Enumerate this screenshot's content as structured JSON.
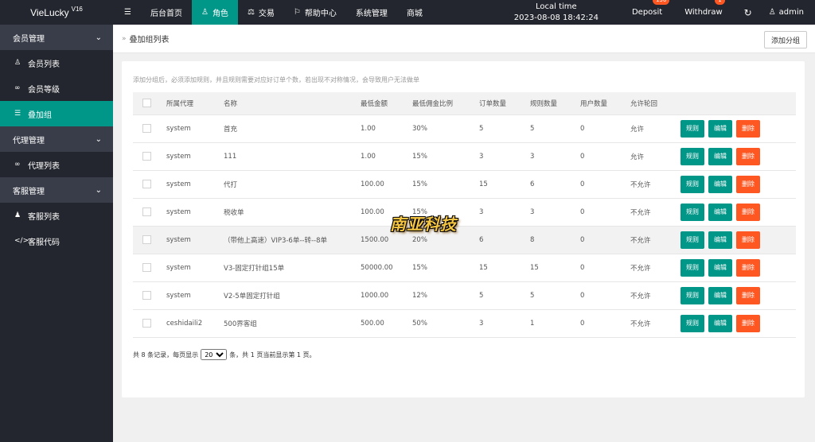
{
  "app": {
    "title": "VieLucky",
    "version": "V16"
  },
  "topnav": {
    "menu_icon": "menu-icon",
    "items": [
      {
        "label": "后台首页",
        "icon": ""
      },
      {
        "label": "角色",
        "icon": "user-icon",
        "active": true
      },
      {
        "label": "交易",
        "icon": "scale-icon"
      },
      {
        "label": "帮助中心",
        "icon": "flag-icon"
      },
      {
        "label": "系统管理",
        "icon": ""
      },
      {
        "label": "商城",
        "icon": ""
      }
    ],
    "clock_label": "Local time",
    "clock_value": "2023-08-08 18:42:24",
    "deposit": {
      "label": "Deposit",
      "badge": "136"
    },
    "withdraw": {
      "label": "Withdraw",
      "badge": "1"
    },
    "refresh_icon": "refresh-icon",
    "user": {
      "label": "admin",
      "icon": "user-icon"
    }
  },
  "sidebar": {
    "groups": [
      {
        "label": "会员管理",
        "items": [
          {
            "label": "会员列表",
            "icon": "user-icon"
          },
          {
            "label": "会员等级",
            "icon": "link-icon"
          },
          {
            "label": "叠加组",
            "icon": "list-icon",
            "active": true
          }
        ]
      },
      {
        "label": "代理管理",
        "items": [
          {
            "label": "代理列表",
            "icon": "link-icon"
          }
        ]
      },
      {
        "label": "客服管理",
        "items": [
          {
            "label": "客服列表",
            "icon": "users-icon"
          },
          {
            "label": "客服代码",
            "icon": "code-icon"
          }
        ]
      }
    ]
  },
  "breadcrumb": {
    "title": "叠加组列表"
  },
  "add_button": "添加分组",
  "tip": "添加分组后，必须添加规则，并且规则需要对应好订单个数，若出现不对称情况，会导致用户无法做单",
  "table": {
    "headers": [
      "所属代理",
      "名称",
      "最低金额",
      "最低佣金比例",
      "订单数量",
      "规则数量",
      "用户数量",
      "允许轮回"
    ],
    "rows": [
      [
        "system",
        "首充",
        "1.00",
        "30%",
        "5",
        "5",
        "0",
        "允许"
      ],
      [
        "system",
        "111",
        "1.00",
        "15%",
        "3",
        "3",
        "0",
        "允许"
      ],
      [
        "system",
        "代打",
        "100.00",
        "15%",
        "15",
        "6",
        "0",
        "不允许"
      ],
      [
        "system",
        "税收单",
        "100.00",
        "15%",
        "3",
        "3",
        "0",
        "不允许"
      ],
      [
        "system",
        "（带他上高速）VIP3-6单--转--8单",
        "1500.00",
        "20%",
        "6",
        "8",
        "0",
        "不允许"
      ],
      [
        "system",
        "V3-固定打针组15单",
        "50000.00",
        "15%",
        "15",
        "15",
        "0",
        "不允许"
      ],
      [
        "system",
        "V2-5单固定打针组",
        "1000.00",
        "12%",
        "5",
        "5",
        "0",
        "不允许"
      ],
      [
        "ceshidaili2",
        "500界客组",
        "500.00",
        "50%",
        "3",
        "1",
        "0",
        "不允许"
      ]
    ],
    "actions": [
      "规则",
      "编辑",
      "删除"
    ]
  },
  "pager": {
    "prefix": "共 8 条记录，每页显示",
    "page_size": "20",
    "suffix": "条，共 1 页当前显示第 1 页。"
  },
  "watermark": "南亚科技",
  "colors": {
    "accent": "#009688",
    "danger": "#ff5722",
    "dark": "#23262e"
  }
}
